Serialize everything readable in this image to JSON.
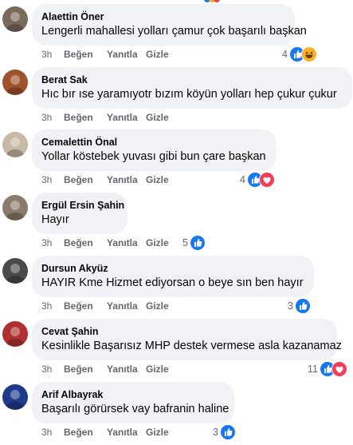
{
  "comments": [
    {
      "author": "Alaettin Öner",
      "text": "Lengerli mahallesi yolları çamur çok başarılı başkan",
      "time": "3h",
      "like": "Beğen",
      "reply": "Yanıtla",
      "hide": "Gizle",
      "reaction_count": "4",
      "reactions": [
        "like-icon",
        "haha-icon"
      ],
      "avatar_color": "#7a6a5a"
    },
    {
      "author": "Berat Sak",
      "text": "Hıc bır ıse yaramıyotr bızım köyün yolları hep çukur çukur",
      "time": "3h",
      "like": "Beğen",
      "reply": "Yanıtla",
      "hide": "Gizle",
      "reaction_count": "",
      "reactions": [],
      "avatar_color": "#a0522d"
    },
    {
      "author": "Cemalettin Önal",
      "text": "Yollar köstebek yuvası gibi bun çare başkan",
      "time": "3h",
      "like": "Beğen",
      "reply": "Yanıtla",
      "hide": "Gizle",
      "reaction_count": "4",
      "reactions": [
        "like-icon",
        "love-icon"
      ],
      "avatar_color": "#c8b9a6"
    },
    {
      "author": "Ergül Ersin Şahin",
      "text": "Hayır",
      "time": "3h",
      "like": "Beğen",
      "reply": "Yanıtla",
      "hide": "Gizle",
      "reaction_count": "5",
      "reactions": [
        "like-icon"
      ],
      "avatar_color": "#8a7b6a"
    },
    {
      "author": "Dursun Akyüz",
      "text": "HAYIR Kme Hizmet ediyorsan o beye sın ben hayır",
      "time": "3h",
      "like": "Beğen",
      "reply": "Yanıtla",
      "hide": "Gizle",
      "reaction_count": "3",
      "reactions": [
        "like-icon"
      ],
      "avatar_color": "#4a4a4a"
    },
    {
      "author": "Cevat Şahin",
      "text": "Kesinlikle Başarısız MHP destek vermese asla kazanamaz",
      "time": "3h",
      "like": "Beğen",
      "reply": "Yanıtla",
      "hide": "Gizle",
      "reaction_count": "11",
      "reactions": [
        "like-icon",
        "love-icon"
      ],
      "avatar_color": "#b03030"
    },
    {
      "author": "Arif Albayrak",
      "text": "Başarılı görürsek vay bafranin haline",
      "time": "3h",
      "like": "Beğen",
      "reply": "Yanıtla",
      "hide": "Gizle",
      "reaction_count": "3",
      "reactions": [
        "like-icon"
      ],
      "avatar_color": "#1e3a8a"
    }
  ],
  "colors": {
    "like": "#1877f2",
    "love": "#f33e58",
    "haha": "#f7b125",
    "text_secondary": "#65676b",
    "bubble": "#f0f2f5"
  }
}
